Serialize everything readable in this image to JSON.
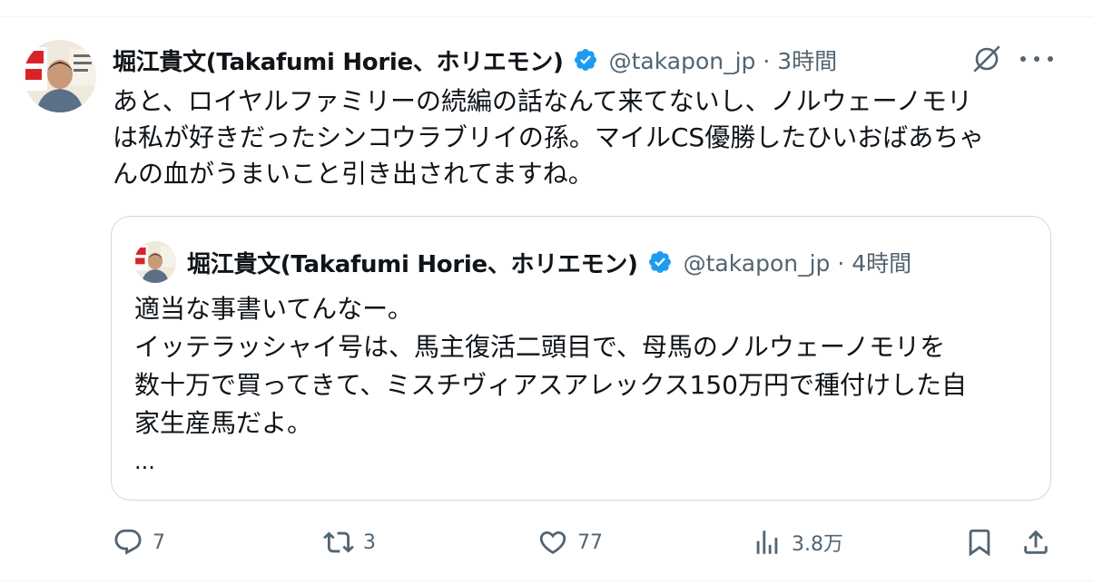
{
  "tweet": {
    "author_name": "堀江貴文(Takafumi Horie、ホリエモン)",
    "handle": "@takapon_jp",
    "separator": "·",
    "time": "3時間",
    "text_lines": [
      "あと、ロイヤルファミリーの続編の話なんて来てないし、ノルウェーノモリ",
      "は私が好きだったシンコウラブリイの孫。マイルCS優勝したひいおばあちゃ",
      "んの血がうまいこと引き出されてますね。"
    ]
  },
  "quote": {
    "author_name": "堀江貴文(Takafumi Horie、ホリエモン)",
    "handle": "@takapon_jp",
    "separator": "·",
    "time": "4時間",
    "text_lines": [
      "適当な事書いてんなー。",
      "イッテラッシャイ号は、馬主復活二頭目で、母馬のノルウェーノモリを",
      "数十万で買ってきて、ミスチヴィアスアレックス150万円で種付けした自",
      "家生産馬だよ。"
    ],
    "ellipsis": "..."
  },
  "actions": {
    "replies": "7",
    "reposts": "3",
    "likes": "77",
    "views": "3.8万"
  },
  "icons": {
    "verified": "verified-badge-icon",
    "grok": "grok-icon",
    "more": "more-icon",
    "reply": "reply-icon",
    "repost": "repost-icon",
    "like": "heart-icon",
    "views": "views-chart-icon",
    "bookmark": "bookmark-icon",
    "share": "share-icon"
  },
  "colors": {
    "verified": "#1d9bf0",
    "text": "#0f1419",
    "muted": "#536471",
    "border": "#cfd9de"
  }
}
